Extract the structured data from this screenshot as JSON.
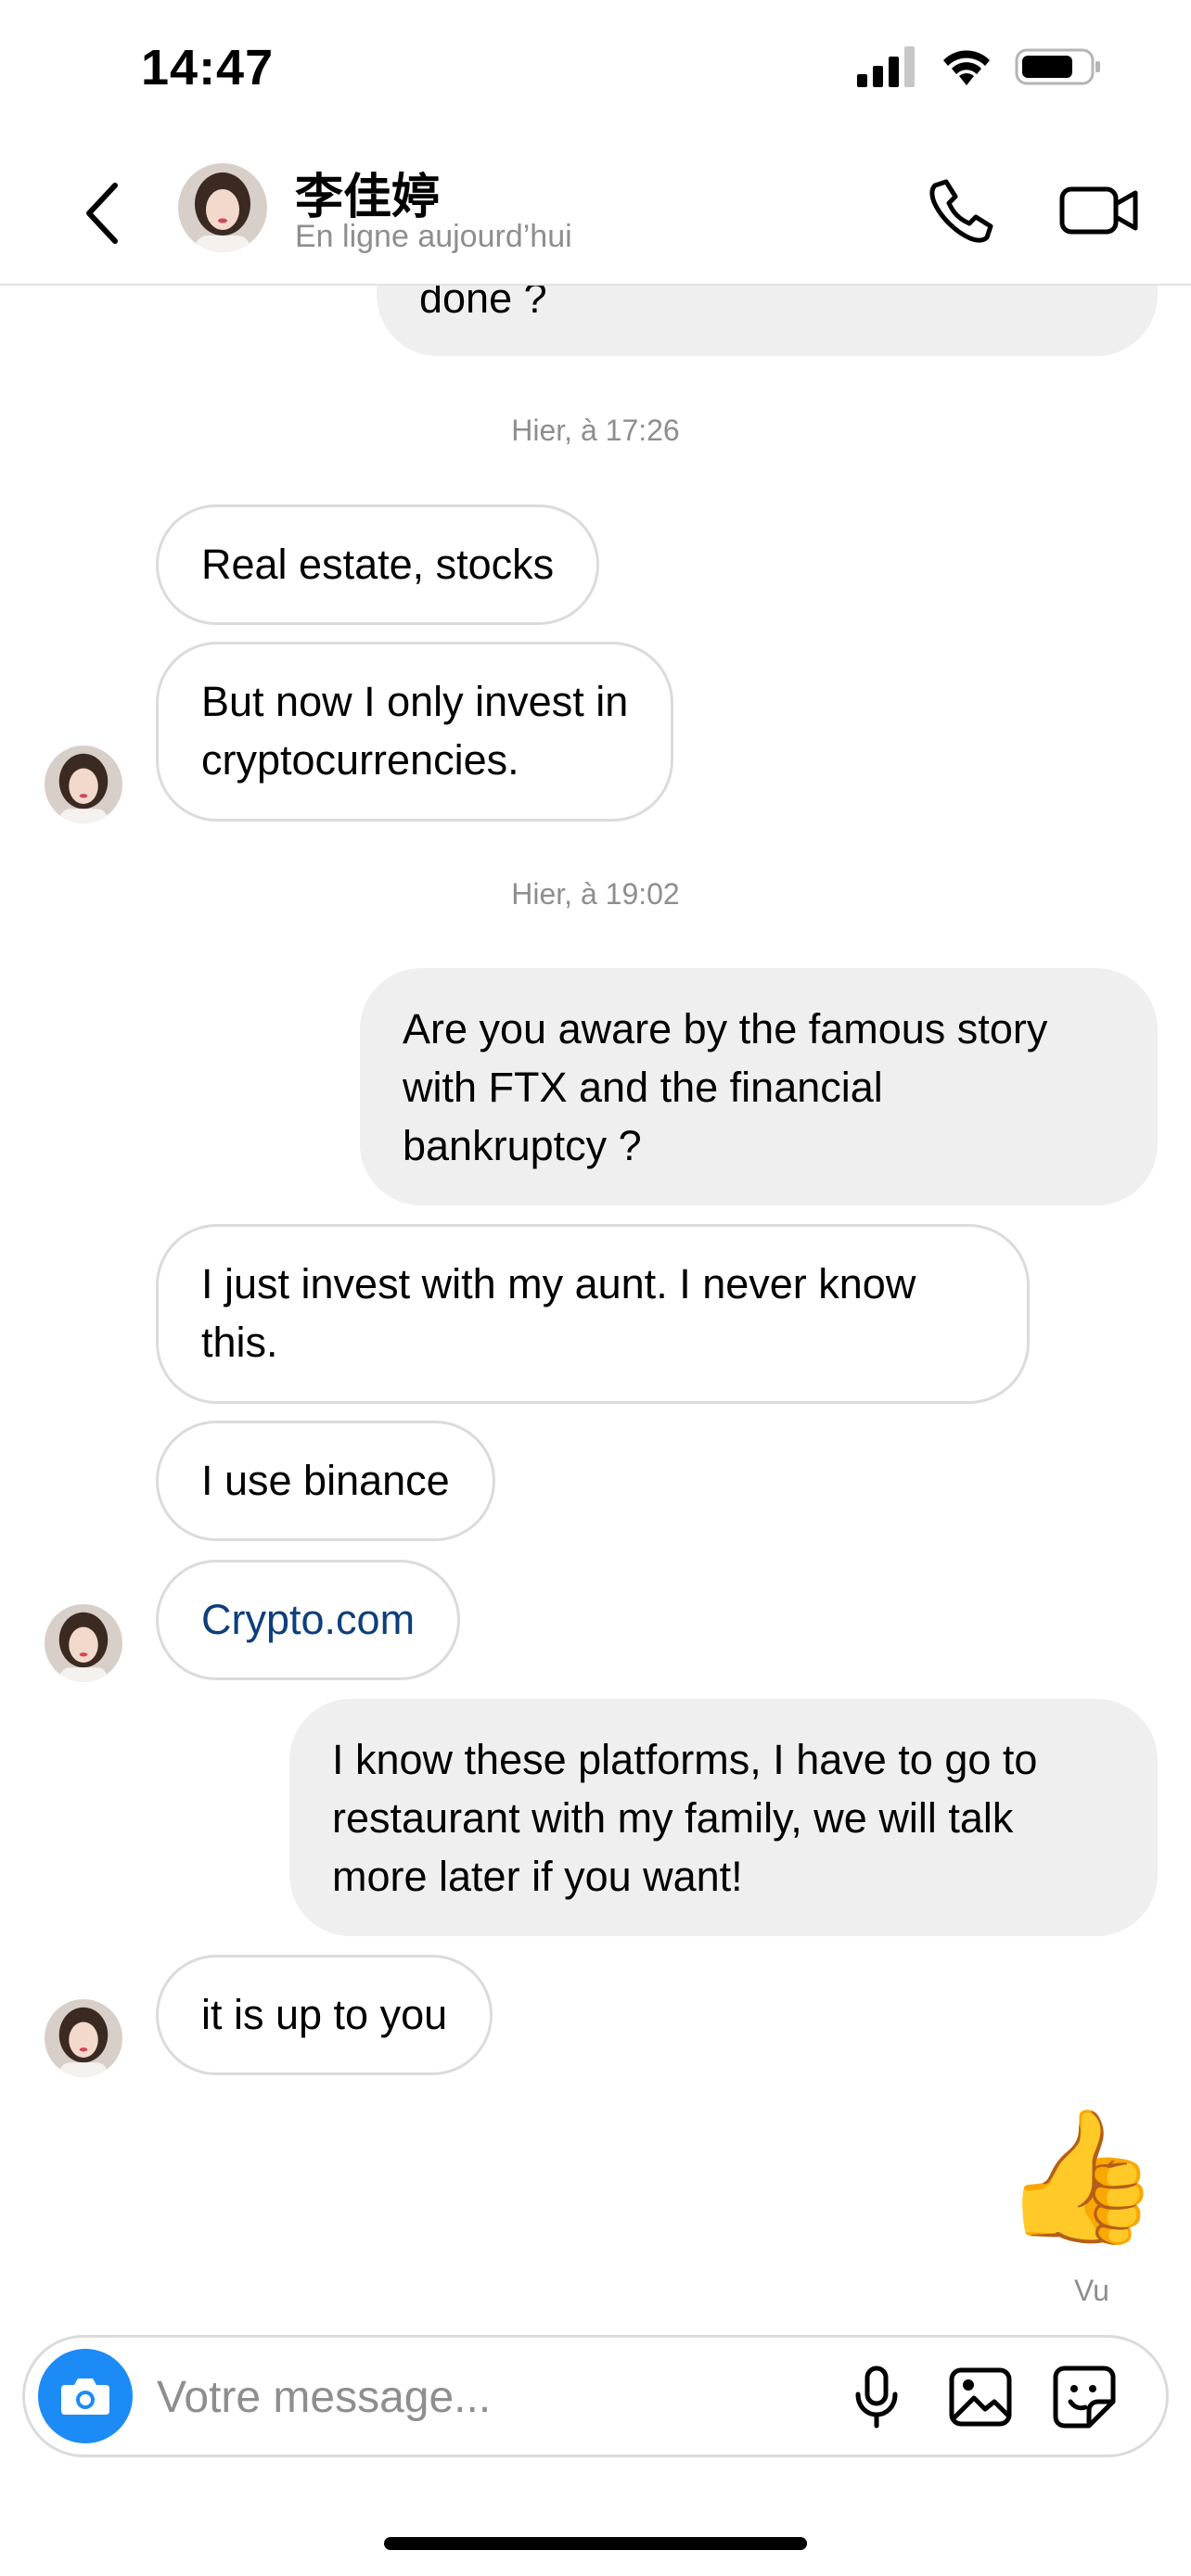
{
  "status_bar": {
    "time": "14:47"
  },
  "header": {
    "contact_name": "李佳婷",
    "contact_status": "En ligne aujourd’hui"
  },
  "messages": {
    "partial_out": "done ?",
    "timestamp_1": "Hier, à 17:26",
    "in_1": "Real estate, stocks",
    "in_2_line1": "But now I only invest in",
    "in_2_line2": "cryptocurrencies.",
    "timestamp_2": "Hier, à 19:02",
    "out_1_line1": "Are you aware by the famous story",
    "out_1_line2": "with FTX and the financial",
    "out_1_line3": "bankruptcy ?",
    "in_3_line1": "I just invest with my aunt. I never know",
    "in_3_line2": "this.",
    "in_4": "I use binance",
    "in_5_link": "Crypto.com",
    "out_2_line1": "I know these platforms, I have to go to",
    "out_2_line2": "restaurant with my family, we will talk",
    "out_2_line3": "more later if you want!",
    "in_6": "it is up to you",
    "reaction_emoji": "👍",
    "seen_label": "Vu"
  },
  "composer": {
    "placeholder": "Votre message..."
  },
  "icons": {
    "back": "chevron-left-icon",
    "call": "phone-icon",
    "video": "video-camera-icon",
    "camera": "camera-icon",
    "mic": "microphone-icon",
    "gallery": "image-icon",
    "sticker": "sticker-icon"
  },
  "colors": {
    "camera_button": "#1d8bf5",
    "outgoing_bubble": "#efefef",
    "link": "#0d3f7c",
    "secondary_text": "#8e8e8e"
  }
}
